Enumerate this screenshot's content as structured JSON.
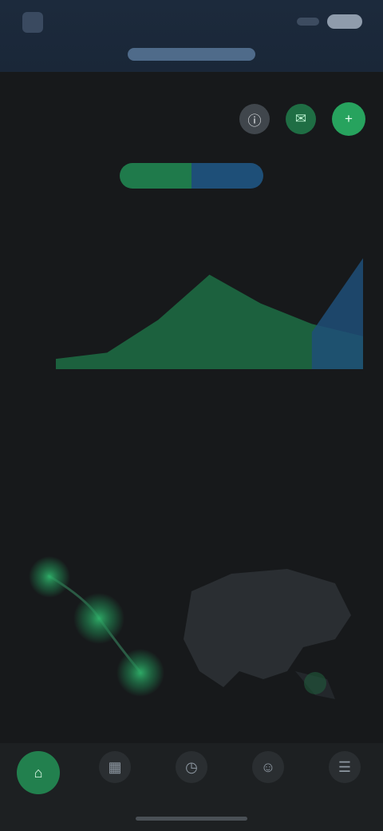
{
  "app": {
    "brand": "",
    "tab_active": ""
  },
  "header": {
    "title": "",
    "subtitle": "",
    "caption": "",
    "segments": [
      "",
      ""
    ]
  },
  "actions": [
    {
      "icon": "info-icon"
    },
    {
      "icon": "chat-icon"
    },
    {
      "icon": "add-icon"
    }
  ],
  "colors": {
    "accent_green": "#27a35e",
    "accent_blue": "#1e4f78",
    "background": "#17191b",
    "topbar": "#1c2a3c"
  },
  "chart_data": {
    "type": "area",
    "title": "",
    "xlabel": "",
    "ylabel": "",
    "categories": [
      "",
      "",
      "",
      "",
      ""
    ],
    "series": [
      {
        "values": [
          0.5,
          0.8,
          2.4,
          4.6,
          3.2,
          2.2,
          1.6
        ],
        "color": "#1f7a4b"
      },
      {
        "values": [
          0,
          0,
          0,
          0,
          0,
          1.8,
          5.4
        ],
        "color": "#1e4f78"
      }
    ],
    "yticks": [
      "",
      "",
      "",
      ""
    ],
    "ylim": [
      0,
      7
    ],
    "grid": false
  },
  "stats": [
    {
      "value": "",
      "label": ""
    },
    {
      "value": "",
      "label": ""
    },
    {
      "value": "",
      "label": ""
    },
    {
      "value": "",
      "label": ""
    }
  ],
  "mid": {
    "left_heading": "",
    "right_heading": "",
    "left_caption": "",
    "right_caption": "",
    "center_caption": ""
  },
  "nav": [
    {
      "icon": "home-icon",
      "label": "",
      "active": true
    },
    {
      "icon": "grid-icon",
      "label": "",
      "active": false
    },
    {
      "icon": "clock-icon",
      "label": "",
      "active": false
    },
    {
      "icon": "person-icon",
      "label": "",
      "active": false
    },
    {
      "icon": "menu-icon",
      "label": "",
      "active": false
    }
  ]
}
